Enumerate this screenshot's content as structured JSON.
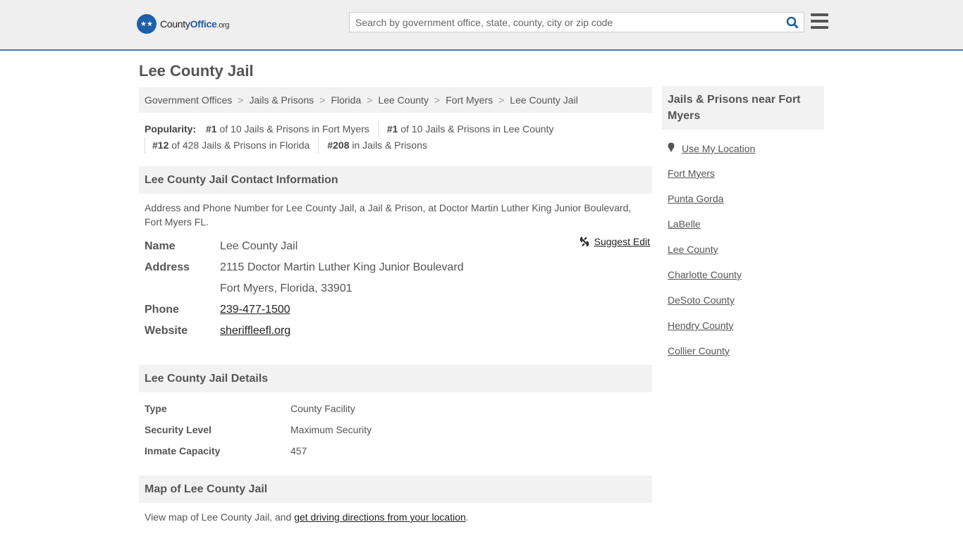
{
  "header": {
    "logo_prefix": "County",
    "logo_bold": "Office",
    "logo_suffix": ".org",
    "search_placeholder": "Search by government office, state, county, city or zip code"
  },
  "page_title": "Lee County Jail",
  "breadcrumbs": [
    "Government Offices",
    "Jails & Prisons",
    "Florida",
    "Lee County",
    "Fort Myers",
    "Lee County Jail"
  ],
  "popularity": {
    "label": "Popularity:",
    "items": [
      {
        "rank": "#1",
        "text": " of 10 Jails & Prisons in Fort Myers"
      },
      {
        "rank": "#1",
        "text": " of 10 Jails & Prisons in Lee County"
      },
      {
        "rank": "#12",
        "text": " of 428 Jails & Prisons in Florida"
      },
      {
        "rank": "#208",
        "text": " in Jails & Prisons"
      }
    ]
  },
  "contact": {
    "heading": "Lee County Jail Contact Information",
    "description": "Address and Phone Number for Lee County Jail, a Jail & Prison, at Doctor Martin Luther King Junior Boulevard, Fort Myers FL.",
    "suggest_edit": "Suggest Edit",
    "name_label": "Name",
    "name": "Lee County Jail",
    "address_label": "Address",
    "address1": "2115 Doctor Martin Luther King Junior Boulevard",
    "address2": "Fort Myers, Florida, 33901",
    "phone_label": "Phone",
    "phone": "239-477-1500",
    "website_label": "Website",
    "website": "sheriffleefl.org"
  },
  "details": {
    "heading": "Lee County Jail Details",
    "rows": [
      {
        "k": "Type",
        "v": "County Facility"
      },
      {
        "k": "Security Level",
        "v": "Maximum Security"
      },
      {
        "k": "Inmate Capacity",
        "v": "457"
      }
    ]
  },
  "map": {
    "heading": "Map of Lee County Jail",
    "text": "View map of Lee County Jail, and ",
    "link": "get driving directions from your location",
    "end": "."
  },
  "sidebar": {
    "heading": "Jails & Prisons near Fort Myers",
    "location": "Use My Location",
    "links": [
      "Fort Myers",
      "Punta Gorda",
      "LaBelle",
      "Lee County",
      "Charlotte County",
      "DeSoto County",
      "Hendry County",
      "Collier County"
    ]
  }
}
